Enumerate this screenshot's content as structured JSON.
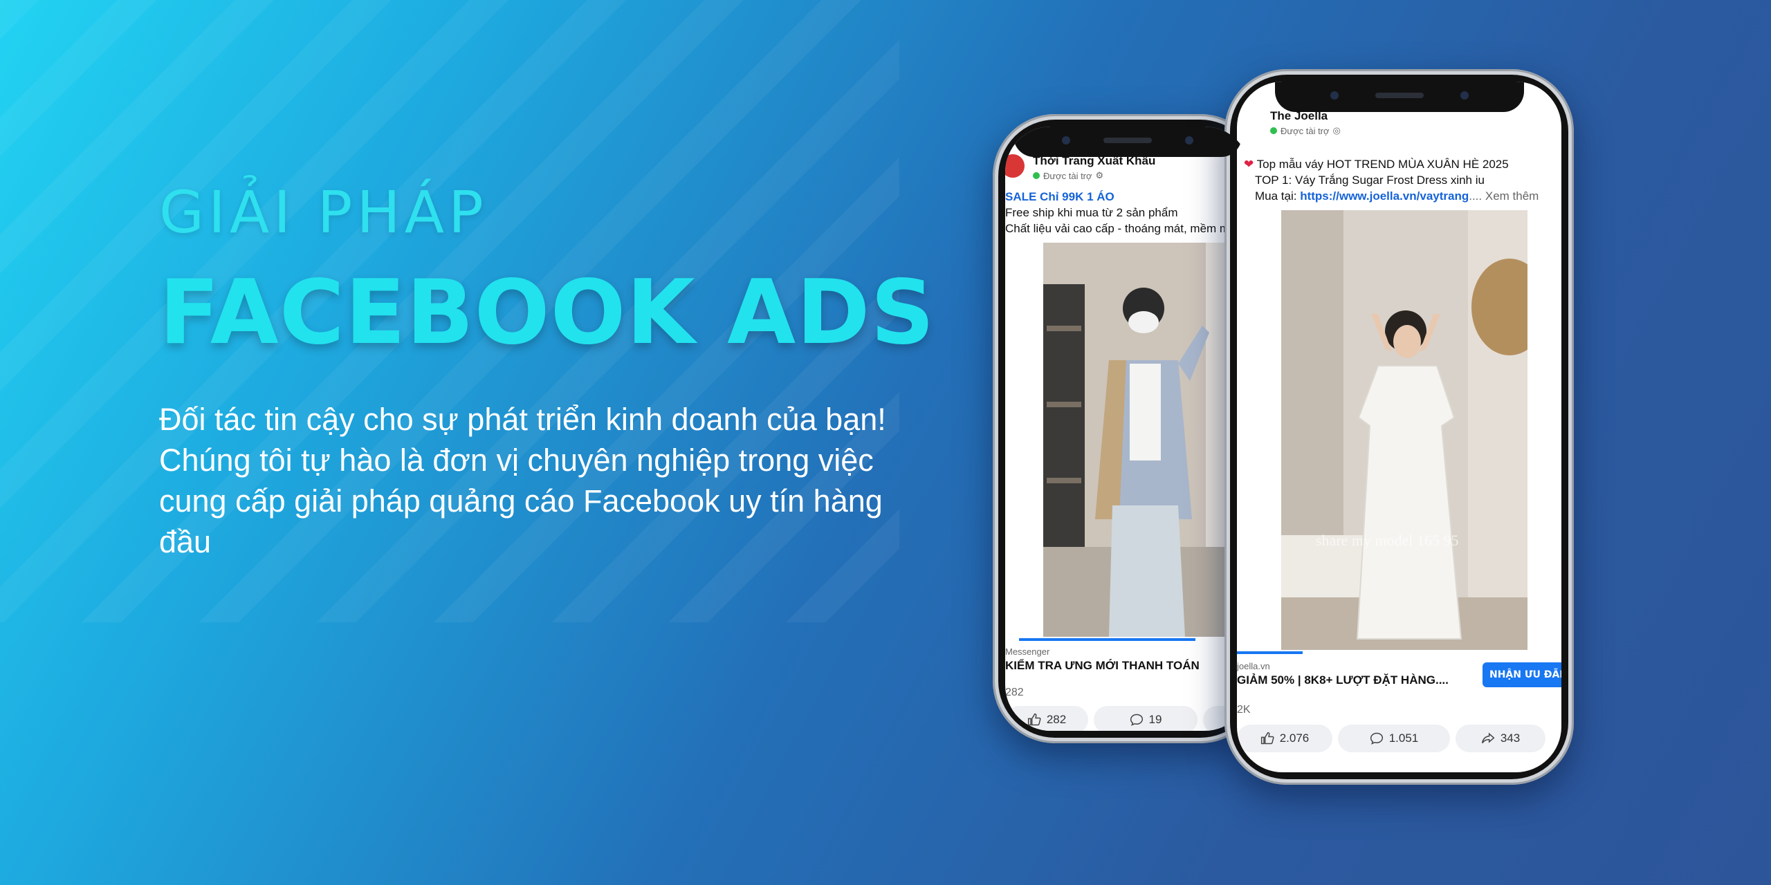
{
  "hero": {
    "kicker": "GIẢI PHÁP",
    "headline": "FACEBOOK ADS",
    "description": "Đối tác tin cậy cho sự phát triển kinh doanh của bạn! Chúng tôi tự hào là đơn vị chuyên nghiệp trong việc cung cấp giải pháp quảng cáo Facebook uy tín hàng đầu"
  },
  "colors": {
    "accent": "#22e2ee",
    "facebook_blue": "#1877f2"
  },
  "phone_left": {
    "page_name": "Thời Trang Xuất Khẩu",
    "sponsored": "Được tài trợ",
    "post_lines": [
      "SALE Chỉ 99K 1 ÁO",
      "Free ship khi mua từ 2 sản phẩm",
      "Chất liệu vải cao cấp - thoáng mát, mềm m"
    ],
    "cta_small": "Messenger",
    "cta_title": "KIỂM TRA ƯNG MỚI THANH TOÁN",
    "reaction_count": "282",
    "likes": "282",
    "comments": "19"
  },
  "phone_right": {
    "page_name": "The Joella",
    "sponsored": "Được tài trợ",
    "post_line_1": "Top mẫu váy HOT TREND MÙA XUÂN HÈ 2025",
    "post_line_2": "TOP 1: Váy Trắng Sugar Frost Dress xinh iu",
    "post_line_3_prefix": "Mua tại: ",
    "post_link": "https://www.joella.vn/vaytrang",
    "see_more": ".... Xem thêm",
    "video_watermark": "share my model 165 95",
    "cta_small": "joella.vn",
    "cta_title": "GIẢM 50% | 8K8+ LƯỢT ĐẶT HÀNG....",
    "cta_button": "NHẬN ƯU ĐÃI",
    "reaction_count": "2K",
    "likes": "2.076",
    "comments": "1.051",
    "shares": "343"
  }
}
